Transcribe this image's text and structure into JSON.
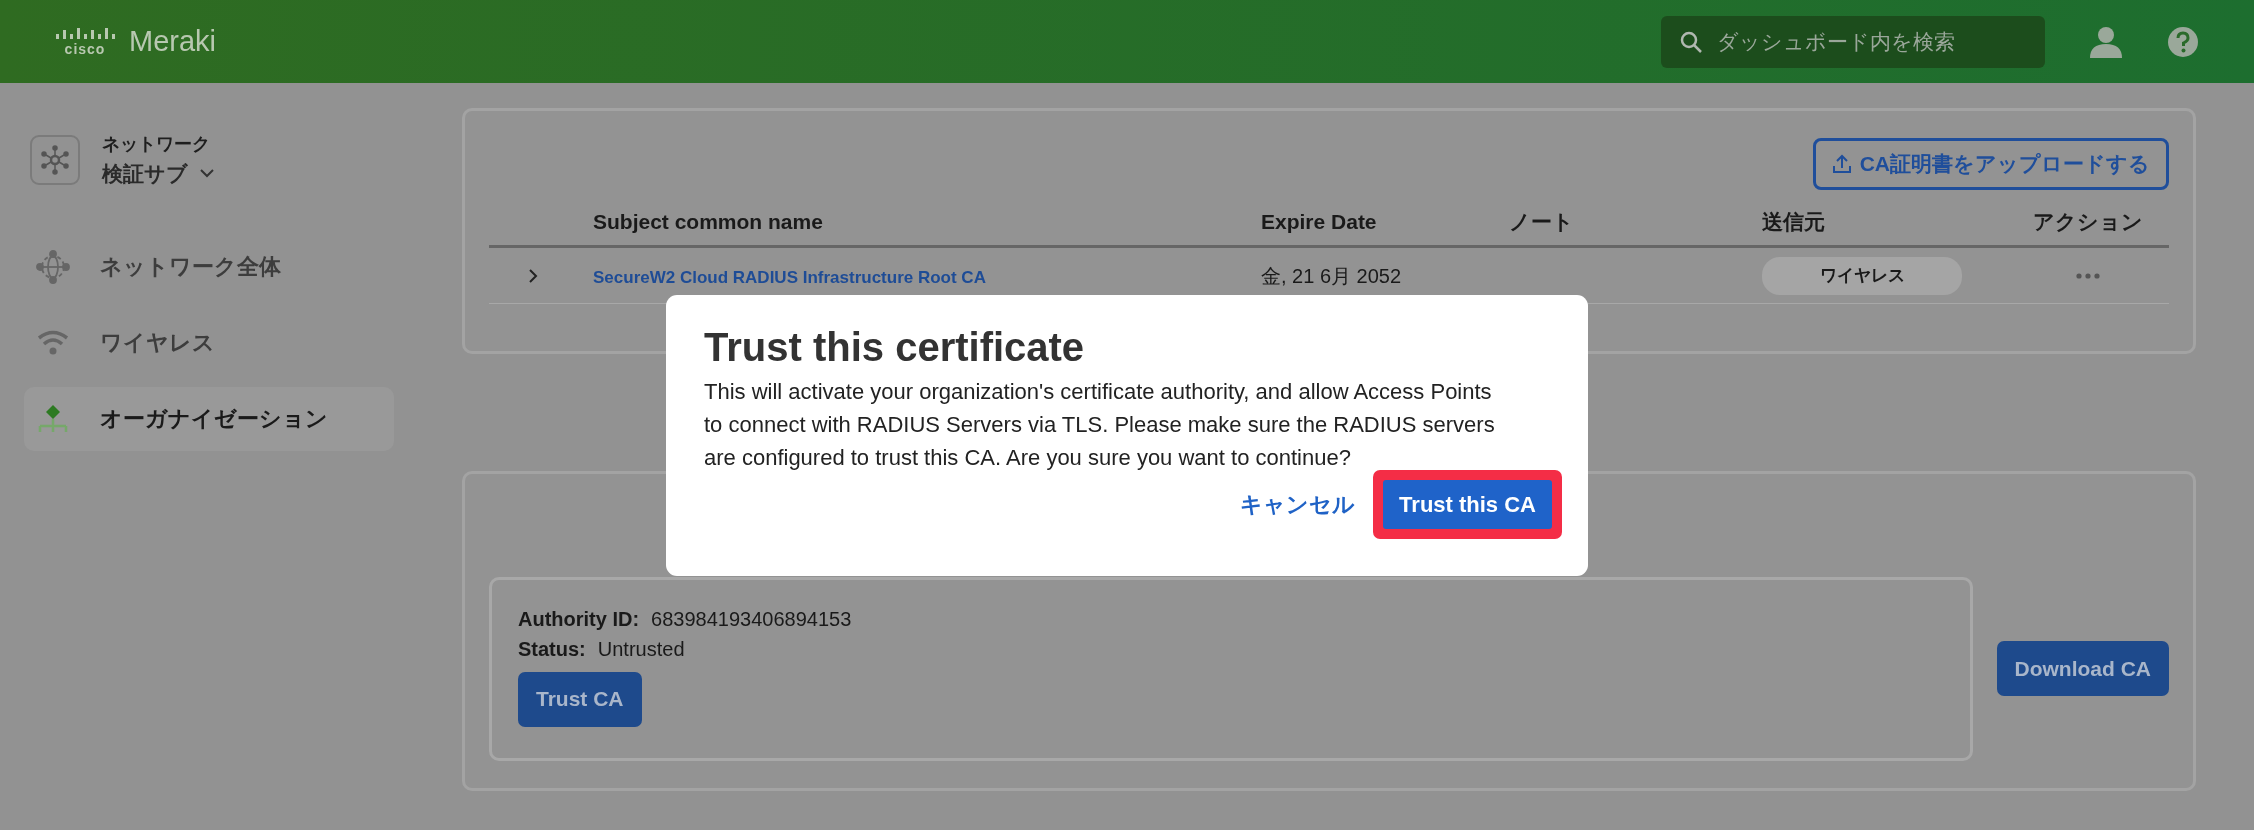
{
  "header": {
    "logo_mark": "cisco",
    "logo_text": "Meraki",
    "search": {
      "placeholder": "ダッシュボード内を検索"
    }
  },
  "sidebar": {
    "network": {
      "label": "ネットワーク",
      "name": "検証サブ"
    },
    "items": [
      {
        "label": "ネットワーク全体",
        "kind": "globe",
        "selected": false
      },
      {
        "label": "ワイヤレス",
        "kind": "wifi",
        "selected": false
      },
      {
        "label": "オーガナイゼーション",
        "kind": "org",
        "selected": true
      }
    ]
  },
  "certificates": {
    "upload_button": "CA証明書をアップロードする",
    "columns": [
      "Subject common name",
      "Expire Date",
      "ノート",
      "送信元",
      "アクション"
    ],
    "rows": [
      {
        "expanded": false,
        "subject": "SecureW2 Cloud RADIUS Infrastructure Root CA",
        "expire": "金, 21 6月 2052",
        "source": "ワイヤレス"
      }
    ]
  },
  "authority": {
    "id_label": "Authority ID:",
    "id_value": "683984193406894153",
    "status_label": "Status:",
    "status_value": "Untrusted",
    "trust_button": "Trust CA",
    "download_button": "Download CA"
  },
  "modal": {
    "title": "Trust this certificate",
    "body": "This will activate your organization's certificate authority, and allow Access Points to connect with RADIUS Servers via TLS. Please make sure the RADIUS servers are configured to trust this CA. Are you sure you want to continue?",
    "cancel": "キャンセル",
    "confirm": "Trust this CA",
    "confirm_highlighted": true
  }
}
